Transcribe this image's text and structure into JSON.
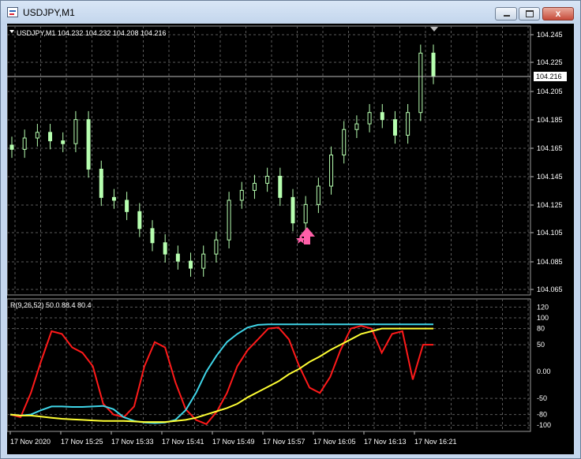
{
  "window": {
    "title": "USDJPY,M1",
    "close_glyph": "x",
    "icons": {
      "app": "chart-app-icon",
      "minimize": "minimize-icon",
      "maximize": "maximize-icon",
      "close": "close-icon"
    }
  },
  "colors": {
    "background": "#000000",
    "grid": "#5a5a5a",
    "text": "#ffffff",
    "candle": "#b7ffb0",
    "signal_arrow": "#ff5fa8",
    "line_red": "#ff1a1a",
    "line_cyan": "#3fd5e8",
    "line_yellow": "#ffff33",
    "titlebar": "#c8d9ee"
  },
  "chart": {
    "header": "USDJPY,M1  104.232 104.232 104.208 104.216",
    "current_price_label": "104.216",
    "price_ticks": [
      "104.245",
      "104.225",
      "104.205",
      "104.185",
      "104.165",
      "104.145",
      "104.125",
      "104.105",
      "104.085",
      "104.065"
    ],
    "time_ticks": [
      "17 Nov 2020",
      "17 Nov 15:25",
      "17 Nov 15:33",
      "17 Nov 15:41",
      "17 Nov 15:49",
      "17 Nov 15:57",
      "17 Nov 16:05",
      "17 Nov 16:13",
      "17 Nov 16:21"
    ]
  },
  "indicator": {
    "header": "R(9,26,52) 50.0 88.4 80.4",
    "ticks": [
      "120",
      "100",
      "80",
      "50",
      "0.00",
      "-50",
      "-80",
      "-100"
    ]
  },
  "chart_data": [
    {
      "type": "candlestick",
      "title": "USDJPY,M1",
      "ylim": [
        104.06,
        104.25
      ],
      "x": [
        "17 Nov 2020",
        "17 Nov 15:25",
        "17 Nov 15:33",
        "17 Nov 15:41",
        "17 Nov 15:49",
        "17 Nov 15:57",
        "17 Nov 16:05",
        "17 Nov 16:13",
        "17 Nov 16:21"
      ],
      "close_approx": [
        104.164,
        104.172,
        104.176,
        104.17,
        104.168,
        104.185,
        104.15,
        104.13,
        104.128,
        104.12,
        104.108,
        104.098,
        104.09,
        104.085,
        104.08,
        104.09,
        104.1,
        104.128,
        104.135,
        104.14,
        104.145,
        104.13,
        104.112,
        104.125,
        104.138,
        104.16,
        104.178,
        104.182,
        104.19,
        104.185,
        104.174,
        104.19,
        104.232,
        104.216
      ],
      "signal": {
        "type": "buy-arrow",
        "price_approx": 104.105
      }
    },
    {
      "type": "line",
      "title": "R(9,26,52)",
      "ylim": [
        -110,
        125
      ],
      "series": [
        {
          "name": "9",
          "last": 50.0,
          "values": [
            -80,
            -85,
            -40,
            20,
            75,
            70,
            45,
            35,
            10,
            -60,
            -80,
            -85,
            -65,
            10,
            55,
            45,
            -20,
            -70,
            -90,
            -98,
            -75,
            -40,
            10,
            40,
            60,
            80,
            82,
            60,
            10,
            -30,
            -40,
            -10,
            40,
            80,
            85,
            80,
            35,
            70,
            75,
            -15,
            50,
            50
          ]
        },
        {
          "name": "26",
          "last": 88.4,
          "values": [
            -80,
            -82,
            -80,
            -72,
            -65,
            -65,
            -66,
            -66,
            -65,
            -64,
            -70,
            -85,
            -92,
            -95,
            -96,
            -95,
            -90,
            -72,
            -40,
            0,
            30,
            55,
            70,
            82,
            87,
            88,
            88,
            88,
            88,
            88,
            88,
            88,
            88,
            88,
            88,
            88,
            88,
            88,
            88,
            88,
            88,
            88
          ]
        },
        {
          "name": "52",
          "last": 80.4,
          "values": [
            -80,
            -82,
            -82,
            -84,
            -86,
            -88,
            -89,
            -90,
            -91,
            -92,
            -92,
            -92,
            -93,
            -94,
            -94,
            -94,
            -92,
            -90,
            -86,
            -80,
            -74,
            -68,
            -60,
            -48,
            -38,
            -28,
            -18,
            -5,
            5,
            18,
            28,
            40,
            50,
            60,
            70,
            75,
            80,
            80,
            80,
            80,
            80,
            80
          ]
        }
      ]
    }
  ]
}
